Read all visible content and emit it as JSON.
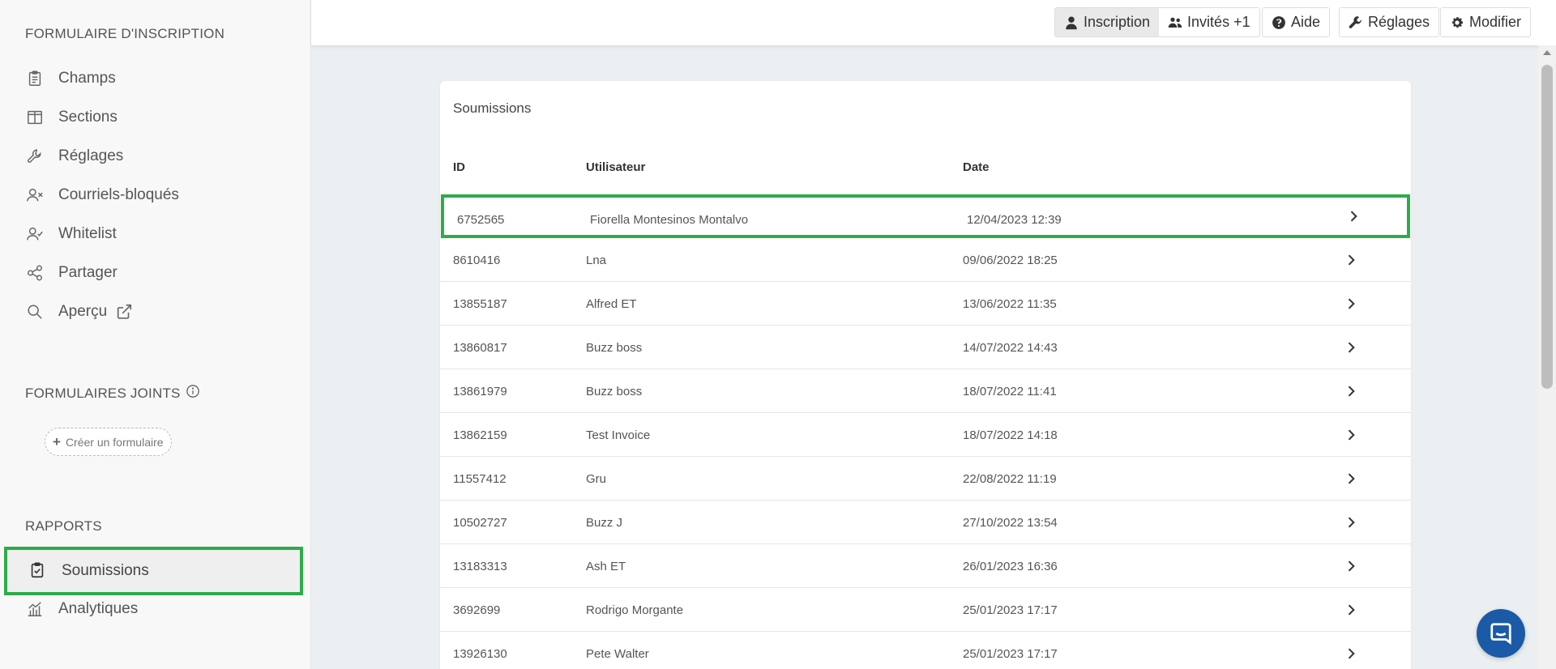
{
  "sidebar": {
    "form_section_title": "FORMULAIRE D'INSCRIPTION",
    "items": [
      {
        "label": "Champs",
        "icon": "clipboard-icon"
      },
      {
        "label": "Sections",
        "icon": "columns-icon"
      },
      {
        "label": "Réglages",
        "icon": "wrench-icon"
      },
      {
        "label": "Courriels-bloqués",
        "icon": "user-x-icon"
      },
      {
        "label": "Whitelist",
        "icon": "user-check-icon"
      },
      {
        "label": "Partager",
        "icon": "share-icon"
      },
      {
        "label": "Aperçu",
        "icon": "search-icon"
      }
    ],
    "joined_section_title": "FORMULAIRES JOINTS",
    "create_form_label": "Créer un formulaire",
    "reports_section_title": "RAPPORTS",
    "reports_items": [
      {
        "label": "Soumissions",
        "icon": "clipboard-check-icon",
        "active": true
      },
      {
        "label": "Analytiques",
        "icon": "chart-icon"
      }
    ]
  },
  "topbar": {
    "registration_label": "Inscription",
    "guests_label": "Invités +1",
    "help_label": "Aide",
    "settings_label": "Réglages",
    "edit_label": "Modifier"
  },
  "submissions": {
    "title": "Soumissions",
    "columns": [
      "ID",
      "Utilisateur",
      "Date"
    ],
    "rows": [
      {
        "id": "6752565",
        "user": "Fiorella Montesinos Montalvo",
        "date": "12/04/2023 12:39"
      },
      {
        "id": "8610416",
        "user": "Lna",
        "date": "09/06/2022 18:25"
      },
      {
        "id": "13855187",
        "user": "Alfred ET",
        "date": "13/06/2022 11:35"
      },
      {
        "id": "13860817",
        "user": "Buzz boss",
        "date": "14/07/2022 14:43"
      },
      {
        "id": "13861979",
        "user": "Buzz boss",
        "date": "18/07/2022 11:41"
      },
      {
        "id": "13862159",
        "user": "Test Invoice",
        "date": "18/07/2022 14:18"
      },
      {
        "id": "11557412",
        "user": "Gru",
        "date": "22/08/2022 11:19"
      },
      {
        "id": "10502727",
        "user": "Buzz J",
        "date": "27/10/2022 13:54"
      },
      {
        "id": "13183313",
        "user": "Ash ET",
        "date": "26/01/2023 16:36"
      },
      {
        "id": "3692699",
        "user": "Rodrigo Morgante",
        "date": "25/01/2023 17:17"
      },
      {
        "id": "13926130",
        "user": "Pete Walter",
        "date": "25/01/2023 17:17"
      }
    ]
  },
  "colors": {
    "highlight": "#2eab4a",
    "chat_button": "#1b5aa6"
  }
}
